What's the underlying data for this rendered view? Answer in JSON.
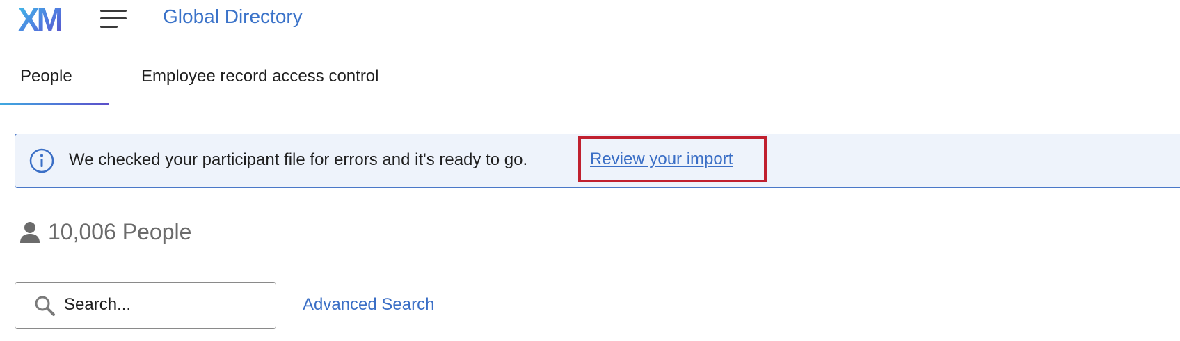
{
  "header": {
    "logo_text": "XM",
    "app_title": "Global Directory",
    "menu_icon": "hamburger-menu-icon",
    "brand_colors": [
      "#3fa9e0",
      "#5271d6",
      "#5b4fc9"
    ]
  },
  "tabs": [
    {
      "label": "People",
      "active": true
    },
    {
      "label": "Employee record access control",
      "active": false
    }
  ],
  "banner": {
    "icon": "info-icon",
    "message": "We checked your participant file for errors and it's ready to go.",
    "link_label": "Review your import",
    "highlight_color": "#c0202f",
    "accent_color": "#4a78c8"
  },
  "people": {
    "icon": "person-icon",
    "count_label": "10,006 People"
  },
  "search": {
    "icon": "search-icon",
    "placeholder": "Search...",
    "value": "",
    "advanced_label": "Advanced Search"
  }
}
